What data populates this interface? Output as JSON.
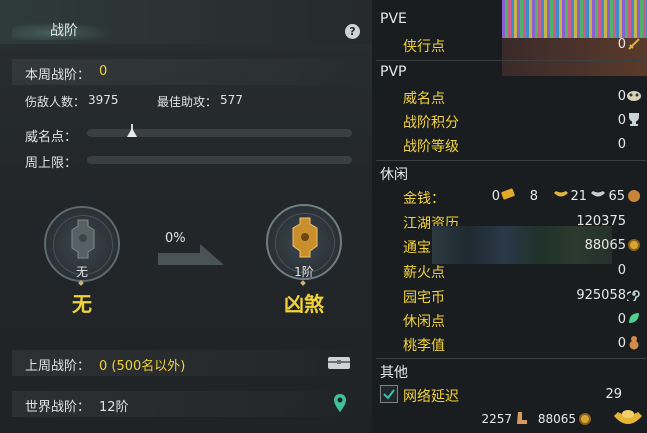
{
  "left": {
    "title": "战阶",
    "help": "?",
    "weekly_rank_label": "本周战阶：",
    "weekly_rank_value": "0",
    "injured_label": "伤敌人数：",
    "injured_value": "3975",
    "assist_label": "最佳助攻：",
    "assist_value": "577",
    "prestige_label": "威名点：",
    "weekly_cap_label": "周上限：",
    "progress_percent": "0%",
    "current_medal_small": "无",
    "current_rank": "无",
    "next_medal_small": "1阶",
    "next_rank": "凶煞",
    "last_week_label": "上周战阶：",
    "last_week_value": "0 (500名以外)",
    "world_rank_label": "世界战阶：",
    "world_rank_value": "12阶"
  },
  "right": {
    "pve": {
      "title": "PVE",
      "items": [
        {
          "label": "侠行点",
          "value": "0",
          "icon": "sword-icon"
        }
      ]
    },
    "pvp": {
      "title": "PVP",
      "items": [
        {
          "label": "威名点",
          "value": "0",
          "icon": "mask-icon"
        },
        {
          "label": "战阶积分",
          "value": "0",
          "icon": "trophy-icon"
        },
        {
          "label": "战阶等级",
          "value": "0"
        }
      ]
    },
    "leisure": {
      "title": "休闲",
      "money_label": "金钱：",
      "money_gold": "0",
      "money_silver": "8",
      "money_copper1": "21",
      "money_copper2": "65",
      "items": [
        {
          "label": "江湖资历",
          "value": "120375"
        },
        {
          "label": "通宝",
          "value": "88065",
          "icon": "coin-icon"
        },
        {
          "label": "薪火点",
          "value": "0"
        },
        {
          "label": "园宅币",
          "value": "925058",
          "icon": "spiral-icon"
        },
        {
          "label": "休闲点",
          "value": "0",
          "icon": "leaf-icon"
        },
        {
          "label": "桃李值",
          "value": "0",
          "icon": "gourd-icon"
        }
      ]
    },
    "other": {
      "title": "其他",
      "latency_label": "网络延迟",
      "latency_value": "29"
    },
    "footer": {
      "value1": "2257",
      "value2": "88065"
    }
  },
  "colors": {
    "accent_yellow": "#f1d23b",
    "panel_bg": "#1e2224"
  }
}
